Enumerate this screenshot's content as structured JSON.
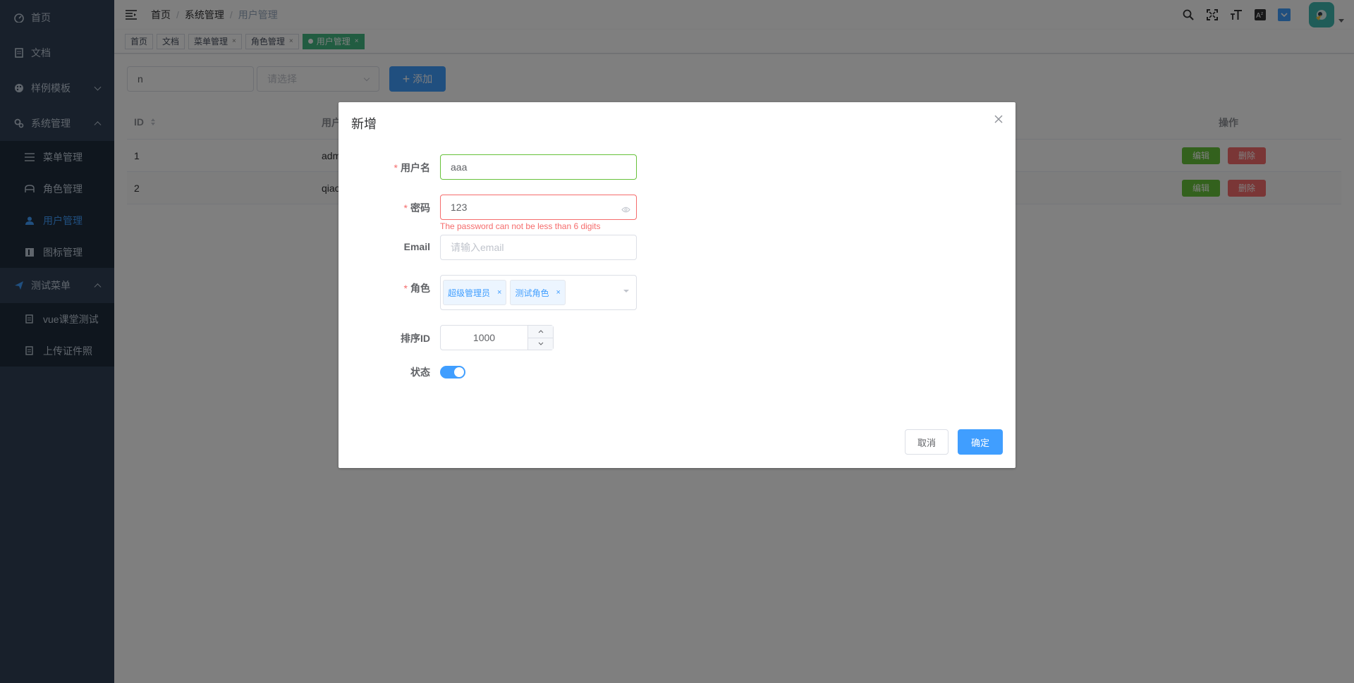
{
  "sidebar": {
    "items": [
      {
        "label": "首页",
        "icon": "dashboard-icon"
      },
      {
        "label": "文档",
        "icon": "document-icon"
      },
      {
        "label": "样例模板",
        "icon": "palette-icon"
      },
      {
        "label": "系统管理",
        "icon": "gears-icon"
      }
    ],
    "system_sub": [
      {
        "label": "菜单管理",
        "icon": "list-icon"
      },
      {
        "label": "角色管理",
        "icon": "role-icon"
      },
      {
        "label": "用户管理",
        "icon": "user-icon"
      },
      {
        "label": "图标管理",
        "icon": "icon-manage-icon"
      }
    ],
    "test_menu": {
      "label": "测试菜单",
      "icon": "send-icon"
    },
    "test_sub": [
      {
        "label": "vue课堂测试",
        "icon": "form-icon"
      },
      {
        "label": "上传证件照",
        "icon": "form-icon"
      }
    ]
  },
  "breadcrumb": [
    "首页",
    "系统管理",
    "用户管理"
  ],
  "tags": [
    {
      "label": "首页"
    },
    {
      "label": "文档"
    },
    {
      "label": "菜单管理"
    },
    {
      "label": "角色管理"
    },
    {
      "label": "用户管理"
    }
  ],
  "filter": {
    "input_value": "n",
    "select_placeholder": "请选择",
    "add_label": "添加"
  },
  "table": {
    "headers": {
      "id": "ID",
      "user": "用户",
      "op": "操作"
    },
    "rows": [
      {
        "id": "1",
        "user": "adm"
      },
      {
        "id": "2",
        "user": "qiao"
      }
    ],
    "edit_label": "编辑",
    "delete_label": "删除"
  },
  "dialog": {
    "title": "新增",
    "username_label": "用户名",
    "username_value": "aaa",
    "password_label": "密码",
    "password_value": "123",
    "password_error": "The password can not be less than 6 digits",
    "email_label": "Email",
    "email_placeholder": "请输入email",
    "role_label": "角色",
    "roles": [
      "超级管理员",
      "测试角色"
    ],
    "sort_label": "排序ID",
    "sort_value": "1000",
    "status_label": "状态",
    "status_on": true,
    "cancel_label": "取消",
    "confirm_label": "确定"
  },
  "colors": {
    "sidebar_bg": "#304156",
    "sidebar_sub_bg": "#1f2d3d",
    "primary": "#409eff",
    "tag_active": "#42b983",
    "success": "#67c23a",
    "danger": "#f56c6c"
  }
}
